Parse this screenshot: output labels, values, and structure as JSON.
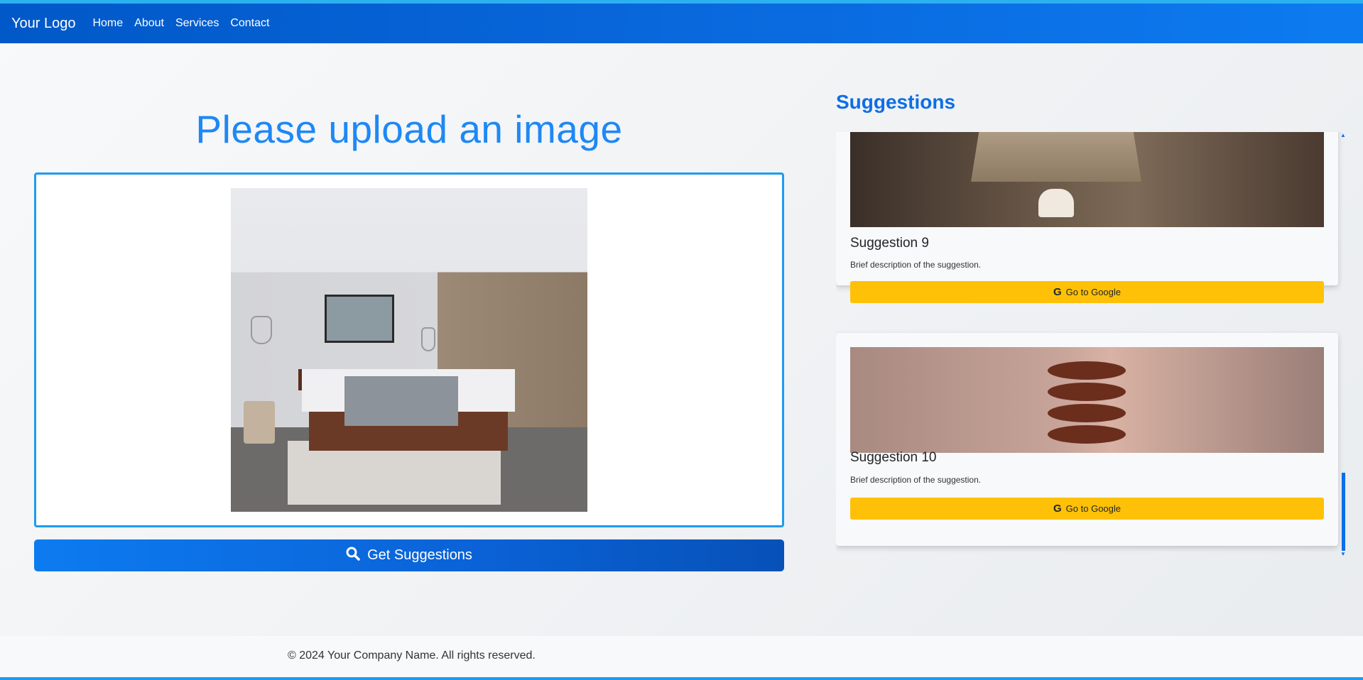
{
  "navbar": {
    "brand": "Your Logo",
    "links": [
      "Home",
      "About",
      "Services",
      "Contact"
    ]
  },
  "upload": {
    "title": "Please upload an image",
    "button_label": "Get Suggestions"
  },
  "suggestions": {
    "heading": "Suggestions",
    "items": [
      {
        "title": "Suggestion 9",
        "description": "Brief description of the suggestion.",
        "button_label": "Go to Google"
      },
      {
        "title": "Suggestion 10",
        "description": "Brief description of the suggestion.",
        "button_label": "Go to Google"
      }
    ]
  },
  "footer": {
    "text": "© 2024 Your Company Name. All rights reserved."
  },
  "colors": {
    "primary": "#0d6ee6",
    "warning": "#ffc107",
    "accent_border": "#1e9bf0"
  },
  "icons": {
    "search": "search-icon",
    "google": "google-icon"
  }
}
